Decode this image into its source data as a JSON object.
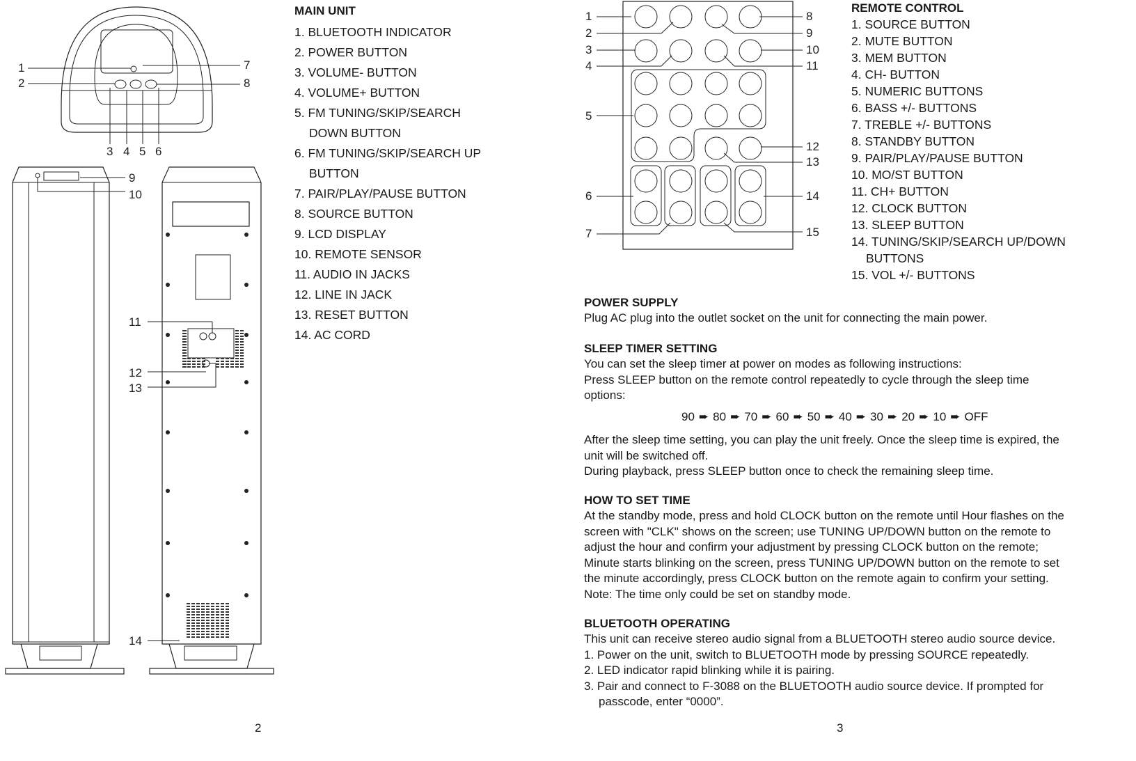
{
  "page_left": {
    "page_number": "2",
    "main_unit": {
      "title": "MAIN UNIT",
      "items": [
        {
          "lines": [
            "1. BLUETOOTH INDICATOR"
          ]
        },
        {
          "lines": [
            "2. POWER BUTTON"
          ]
        },
        {
          "lines": [
            "3. VOLUME- BUTTON"
          ]
        },
        {
          "lines": [
            "4. VOLUME+ BUTTON"
          ]
        },
        {
          "lines": [
            "5. FM TUNING/SKIP/SEARCH",
            "DOWN BUTTON"
          ]
        },
        {
          "lines": [
            "6. FM TUNING/SKIP/SEARCH UP",
            "BUTTON"
          ]
        },
        {
          "lines": [
            "7. PAIR/PLAY/PAUSE BUTTON"
          ]
        },
        {
          "lines": [
            "8. SOURCE BUTTON"
          ]
        },
        {
          "lines": [
            "9. LCD DISPLAY"
          ]
        },
        {
          "lines": [
            "10. REMOTE SENSOR"
          ]
        },
        {
          "lines": [
            "11. AUDIO IN JACKS"
          ]
        },
        {
          "lines": [
            "12. LINE IN JACK"
          ]
        },
        {
          "lines": [
            "13. RESET BUTTON"
          ]
        },
        {
          "lines": [
            "14. AC CORD"
          ]
        }
      ]
    },
    "diagram_labels": {
      "top": [
        "1",
        "2",
        "3",
        "4",
        "5",
        "6",
        "7",
        "8"
      ],
      "tower": [
        "9",
        "10",
        "11",
        "12",
        "13",
        "14"
      ]
    }
  },
  "page_right": {
    "page_number": "3",
    "remote_labels": [
      "1",
      "2",
      "3",
      "4",
      "5",
      "6",
      "7",
      "8",
      "9",
      "10",
      "11",
      "12",
      "13",
      "14",
      "15"
    ],
    "remote_control": {
      "title": "REMOTE CONTROL",
      "items": [
        {
          "lines": [
            "1. SOURCE BUTTON"
          ]
        },
        {
          "lines": [
            "2. MUTE BUTTON"
          ]
        },
        {
          "lines": [
            "3. MEM BUTTON"
          ]
        },
        {
          "lines": [
            "4. CH- BUTTON"
          ]
        },
        {
          "lines": [
            "5. NUMERIC BUTTONS"
          ]
        },
        {
          "lines": [
            "6. BASS +/- BUTTONS"
          ]
        },
        {
          "lines": [
            "7. TREBLE +/- BUTTONS"
          ]
        },
        {
          "lines": [
            "8. STANDBY BUTTON"
          ]
        },
        {
          "lines": [
            "9. PAIR/PLAY/PAUSE BUTTON"
          ]
        },
        {
          "lines": [
            "10. MO/ST BUTTON"
          ]
        },
        {
          "lines": [
            "11. CH+ BUTTON"
          ]
        },
        {
          "lines": [
            "12. CLOCK BUTTON"
          ]
        },
        {
          "lines": [
            "13. SLEEP BUTTON"
          ]
        },
        {
          "lines": [
            "14. TUNING/SKIP/SEARCH UP/DOWN",
            "BUTTONS"
          ]
        },
        {
          "lines": [
            "15. VOL +/- BUTTONS"
          ]
        }
      ]
    },
    "power_supply": {
      "title": "POWER SUPPLY",
      "lines": [
        "Plug AC plug into the outlet socket on the unit for connecting the main power."
      ]
    },
    "sleep_timer": {
      "title": "SLEEP TIMER SETTING",
      "lines_before": [
        "You can set the sleep timer at power on modes as following instructions:",
        "Press SLEEP button on the remote control repeatedly to cycle through the sleep time",
        "options:"
      ],
      "sequence": [
        "90",
        "80",
        "70",
        "60",
        "50",
        "40",
        "30",
        "20",
        "10",
        "OFF"
      ],
      "arrow_glyph": "➨",
      "lines_after": [
        "After the sleep time setting, you can play the unit freely. Once the sleep time is expired, the",
        "unit will be switched off.",
        "During playback, press SLEEP button once to check the remaining sleep time."
      ]
    },
    "set_time": {
      "title": "HOW TO SET TIME",
      "lines": [
        "At the standby mode, press and hold CLOCK button on the remote until Hour flashes on the",
        "screen with \"CLK\" shows on the screen; use TUNING UP/DOWN button on the remote to",
        "adjust the hour and confirm your adjustment by pressing CLOCK button on the remote;",
        "Minute starts blinking on the screen, press TUNING UP/DOWN button on the remote to set",
        "the minute accordingly, press CLOCK button on the remote again to confirm your setting.",
        "Note: The time only could be set on standby mode."
      ]
    },
    "bluetooth": {
      "title": "BLUETOOTH OPERATING",
      "lines": [
        "This unit can receive stereo audio signal from a BLUETOOTH stereo audio source device.",
        "1. Power on the unit, switch to BLUETOOTH mode by pressing SOURCE repeatedly.",
        "2. LED indicator rapid blinking while it is pairing.",
        "3. Pair and connect to F-3088 on the BLUETOOTH audio source device. If prompted for"
      ],
      "continuation": "passcode, enter “0000”."
    }
  }
}
